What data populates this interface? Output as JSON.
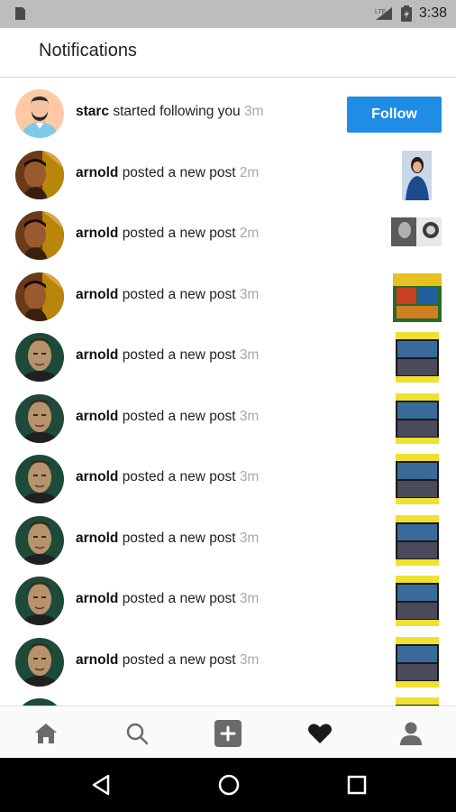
{
  "status_bar": {
    "time": "3:38",
    "icons": [
      "sd-card-icon",
      "signal-icon",
      "battery-icon"
    ]
  },
  "header": {
    "title": "Notifications"
  },
  "notifications": [
    {
      "username": "starc",
      "action": "started following you",
      "time": "3m",
      "avatar": "starc-avatar",
      "trailing": "follow-button"
    },
    {
      "username": "arnold",
      "action": "posted a new post",
      "time": "2m",
      "avatar": "arnold-avatar-a",
      "trailing": "post-thumbnail"
    },
    {
      "username": "arnold",
      "action": "posted a new post",
      "time": "2m",
      "avatar": "arnold-avatar-a",
      "trailing": "post-thumbnail"
    },
    {
      "username": "arnold",
      "action": "posted a new post",
      "time": "3m",
      "avatar": "arnold-avatar-a",
      "trailing": "post-thumbnail"
    },
    {
      "username": "arnold",
      "action": "posted a new post",
      "time": "3m",
      "avatar": "arnold-avatar-b",
      "trailing": "post-thumbnail"
    },
    {
      "username": "arnold",
      "action": "posted a new post",
      "time": "3m",
      "avatar": "arnold-avatar-b",
      "trailing": "post-thumbnail"
    },
    {
      "username": "arnold",
      "action": "posted a new post",
      "time": "3m",
      "avatar": "arnold-avatar-b",
      "trailing": "post-thumbnail"
    },
    {
      "username": "arnold",
      "action": "posted a new post",
      "time": "3m",
      "avatar": "arnold-avatar-b",
      "trailing": "post-thumbnail"
    },
    {
      "username": "arnold",
      "action": "posted a new post",
      "time": "3m",
      "avatar": "arnold-avatar-b",
      "trailing": "post-thumbnail"
    },
    {
      "username": "arnold",
      "action": "posted a new post",
      "time": "3m",
      "avatar": "arnold-avatar-b",
      "trailing": "post-thumbnail"
    }
  ],
  "follow_label": "Follow",
  "tab_bar": {
    "items": [
      {
        "name": "home-icon"
      },
      {
        "name": "search-icon"
      },
      {
        "name": "add-post-icon"
      },
      {
        "name": "heart-icon",
        "active": true
      },
      {
        "name": "profile-icon"
      }
    ]
  },
  "nav_bar": {
    "items": [
      "back-icon",
      "home-circle-icon",
      "recents-icon"
    ]
  },
  "colors": {
    "accent": "#1f8ce6",
    "status_bar": "#bdbdbd",
    "timestamp": "#a8a8a8"
  }
}
